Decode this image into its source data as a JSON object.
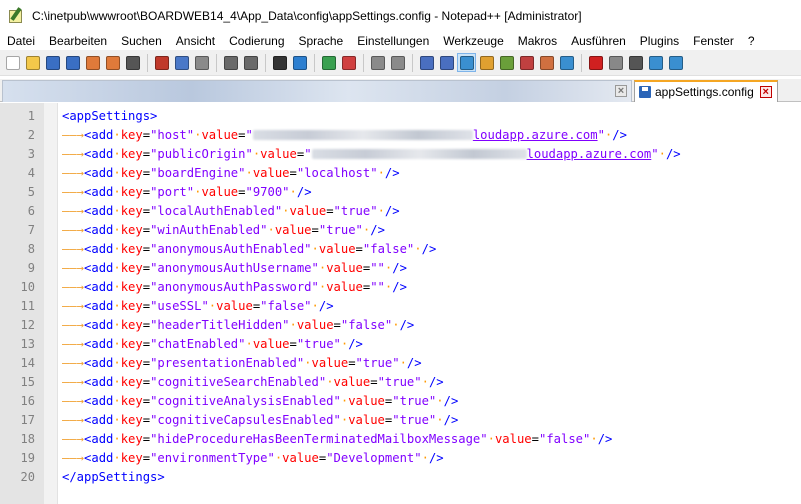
{
  "window": {
    "title": "C:\\inetpub\\wwwroot\\BOARDWEB14_4\\App_Data\\config\\appSettings.config - Notepad++ [Administrator]"
  },
  "menu": [
    "Datei",
    "Bearbeiten",
    "Suchen",
    "Ansicht",
    "Codierung",
    "Sprache",
    "Einstellungen",
    "Werkzeuge",
    "Makros",
    "Ausführen",
    "Plugins",
    "Fenster",
    "?"
  ],
  "toolbar": {
    "buttons": [
      "new-file",
      "open-file",
      "save",
      "save-all",
      "close",
      "close-all",
      "print",
      "cut",
      "copy",
      "paste",
      "undo",
      "redo",
      "find",
      "replace",
      "zoom-in",
      "zoom-out",
      "sync-vertical",
      "sync-horizontal",
      "word-wrap",
      "show-all-chars",
      "indent-guide",
      "user-defined-lang",
      "doc-map",
      "function-list",
      "folder-as-workspace",
      "monitoring",
      "record-macro",
      "stop-record",
      "play-macro",
      "run-macro-multiple",
      "save-macro"
    ]
  },
  "tabs": {
    "active_label": "appSettings.config"
  },
  "editor": {
    "lines": [
      {
        "n": "1",
        "open": "<appSettings>"
      },
      {
        "n": "2",
        "key": "host",
        "value_suffix": "loudapp.azure.com",
        "blur": 220
      },
      {
        "n": "3",
        "key": "publicOrigin",
        "value_suffix": "loudapp.azure.com",
        "blur": 215
      },
      {
        "n": "4",
        "key": "boardEngine",
        "value": "localhost"
      },
      {
        "n": "5",
        "key": "port",
        "value": "9700"
      },
      {
        "n": "6",
        "key": "localAuthEnabled",
        "value": "true"
      },
      {
        "n": "7",
        "key": "winAuthEnabled",
        "value": "true"
      },
      {
        "n": "8",
        "key": "anonymousAuthEnabled",
        "value": "false"
      },
      {
        "n": "9",
        "key": "anonymousAuthUsername",
        "value": ""
      },
      {
        "n": "10",
        "key": "anonymousAuthPassword",
        "value": ""
      },
      {
        "n": "11",
        "key": "useSSL",
        "value": "false"
      },
      {
        "n": "12",
        "key": "headerTitleHidden",
        "value": "false"
      },
      {
        "n": "13",
        "key": "chatEnabled",
        "value": "true"
      },
      {
        "n": "14",
        "key": "presentationEnabled",
        "value": "true"
      },
      {
        "n": "15",
        "key": "cognitiveSearchEnabled",
        "value": "true"
      },
      {
        "n": "16",
        "key": "cognitiveAnalysisEnabled",
        "value": "true"
      },
      {
        "n": "17",
        "key": "cognitiveCapsulesEnabled",
        "value": "true"
      },
      {
        "n": "18",
        "key": "hideProcedureHasBeenTerminatedMailboxMessage",
        "value": "false"
      },
      {
        "n": "19",
        "key": "environmentType",
        "value": "Development"
      },
      {
        "n": "20",
        "close": "</appSettings>"
      }
    ]
  }
}
